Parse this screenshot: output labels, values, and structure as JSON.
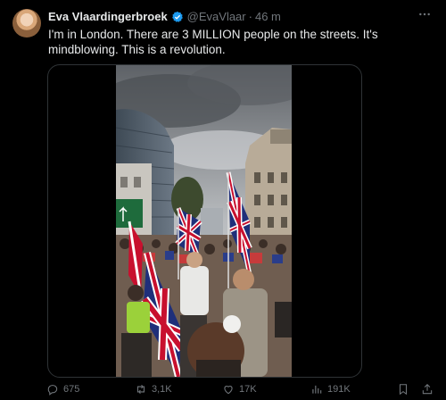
{
  "author": {
    "name": "Eva Vlaardingerbroek",
    "handle": "@EvaVlaar",
    "separator": "·",
    "time": "46 m"
  },
  "tweet": {
    "text": "I'm in London. There are 3 MILLION people on the streets. It's mindblowing. This is a revolution."
  },
  "actions": {
    "replies": "675",
    "reposts": "3,1K",
    "likes": "17K",
    "views": "191K"
  },
  "icons": {
    "verified": "verified-badge-icon",
    "more": "more-icon",
    "reply": "reply-icon",
    "repost": "repost-icon",
    "like": "like-icon",
    "views": "views-icon",
    "bookmark": "bookmark-icon",
    "share": "share-icon"
  },
  "colors": {
    "background": "#000000",
    "text": "#e7e9ea",
    "muted": "#71767b",
    "verified": "#1d9bf0"
  }
}
